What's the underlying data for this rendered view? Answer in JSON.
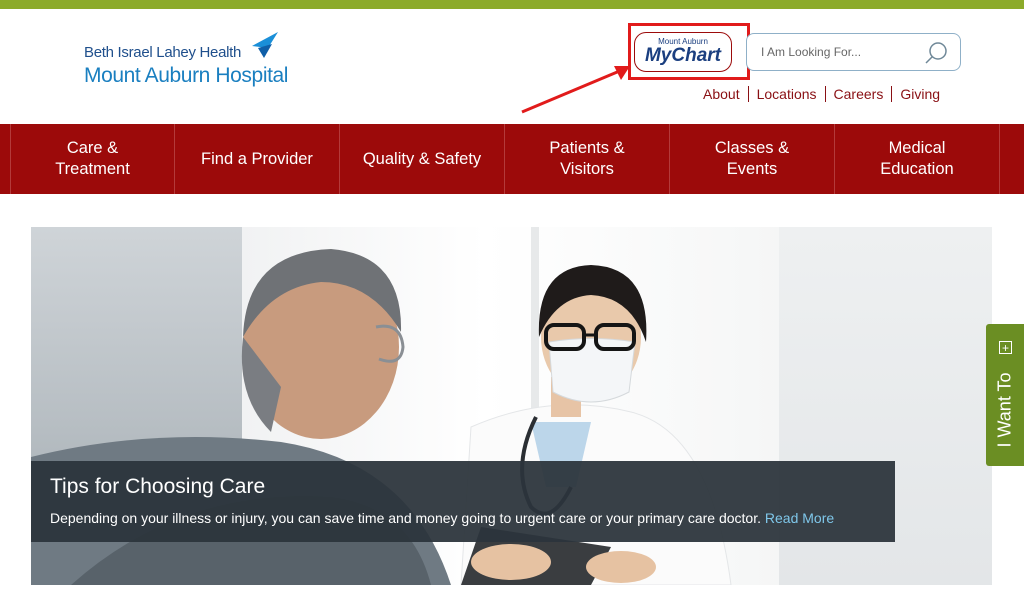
{
  "branding": {
    "org_name": "Beth Israel Lahey Health",
    "hospital_name": "Mount Auburn Hospital",
    "brand_blue": "#1a7fc0",
    "top_bar_color": "#8cab2a"
  },
  "header": {
    "mychart": {
      "small_label": "Mount Auburn",
      "big_label": "MyChart"
    },
    "search": {
      "placeholder": "I Am Looking For...",
      "value": "",
      "icon": "search-icon"
    },
    "utility_links": [
      {
        "label": "About"
      },
      {
        "label": "Locations"
      },
      {
        "label": "Careers"
      },
      {
        "label": "Giving"
      }
    ]
  },
  "nav": {
    "background": "#9c0a0a",
    "items": [
      {
        "label": "Care & Treatment"
      },
      {
        "label": "Find a Provider"
      },
      {
        "label": "Quality & Safety"
      },
      {
        "label": "Patients & Visitors"
      },
      {
        "label": "Classes & Events"
      },
      {
        "label": "Medical Education"
      }
    ]
  },
  "hero": {
    "title": "Tips for Choosing Care",
    "description": "Depending on your illness or injury, you can save time and money going to urgent care or your primary care doctor.",
    "link_label": "Read More"
  },
  "side_tab": {
    "label": "I Want To",
    "icon": "plus-icon",
    "color": "#6b8e23"
  },
  "annotation": {
    "highlight_color": "#e11b1b"
  }
}
